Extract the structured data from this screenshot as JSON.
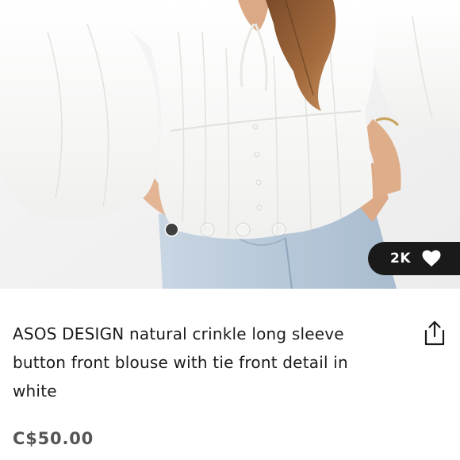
{
  "product": {
    "title": "ASOS DESIGN natural crinkle long sleeve button front blouse with tie front detail in white",
    "price": "C$50.00",
    "likes": "2K",
    "image_alt": "Model wearing white crinkle blouse with light blue jeans"
  },
  "carousel": {
    "total_images": 4,
    "active_index": 0
  },
  "icons": {
    "like": "heart-icon",
    "share": "share-icon"
  },
  "colors": {
    "badge_background": "#1a1a1a",
    "text_primary": "#1a1a1a",
    "price_text": "#555555",
    "active_dot": "#3f3f3f"
  }
}
